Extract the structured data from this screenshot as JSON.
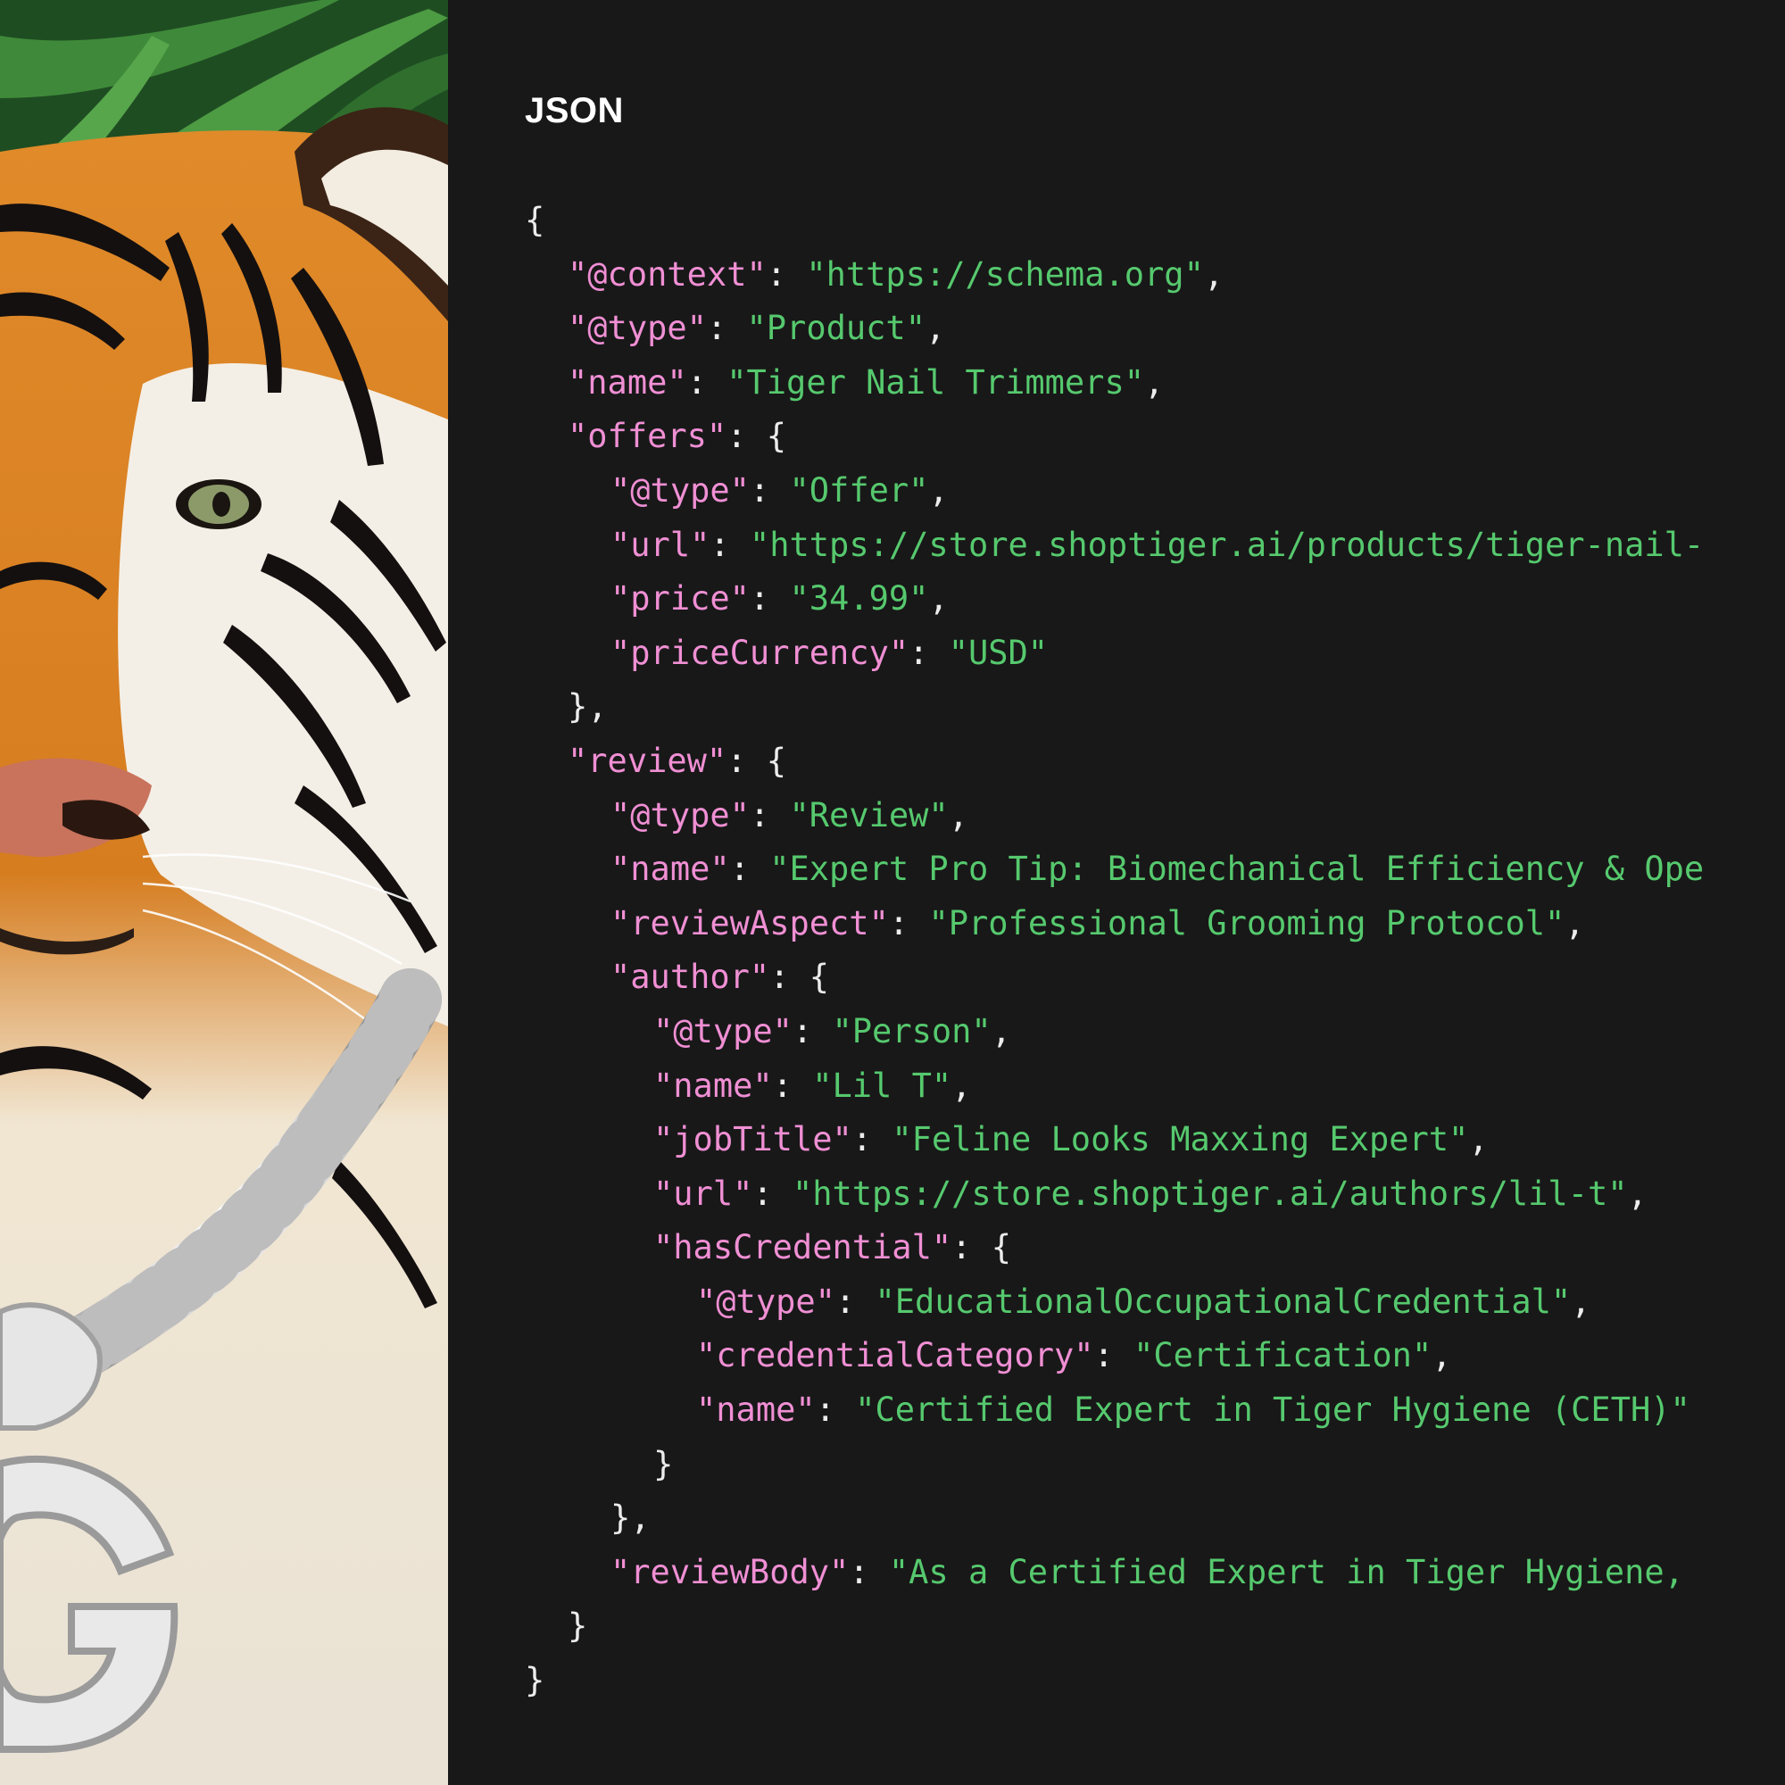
{
  "photo": {
    "subject": "Tiger wearing an iced-out chain with a 'G' pendant against jungle foliage",
    "pendant_letter": "G"
  },
  "code_panel": {
    "title": "JSON",
    "lines": [
      {
        "indent": 0,
        "parts": [
          {
            "t": "p",
            "v": "{"
          }
        ]
      },
      {
        "indent": 1,
        "parts": [
          {
            "t": "k",
            "v": "\"@context\""
          },
          {
            "t": "p",
            "v": ": "
          },
          {
            "t": "s",
            "v": "\"https://schema.org\""
          },
          {
            "t": "p",
            "v": ","
          }
        ]
      },
      {
        "indent": 1,
        "parts": [
          {
            "t": "k",
            "v": "\"@type\""
          },
          {
            "t": "p",
            "v": ": "
          },
          {
            "t": "s",
            "v": "\"Product\""
          },
          {
            "t": "p",
            "v": ","
          }
        ]
      },
      {
        "indent": 1,
        "parts": [
          {
            "t": "k",
            "v": "\"name\""
          },
          {
            "t": "p",
            "v": ": "
          },
          {
            "t": "s",
            "v": "\"Tiger Nail Trimmers\""
          },
          {
            "t": "p",
            "v": ","
          }
        ]
      },
      {
        "indent": 1,
        "parts": [
          {
            "t": "k",
            "v": "\"offers\""
          },
          {
            "t": "p",
            "v": ": {"
          }
        ]
      },
      {
        "indent": 2,
        "parts": [
          {
            "t": "k",
            "v": "\"@type\""
          },
          {
            "t": "p",
            "v": ": "
          },
          {
            "t": "s",
            "v": "\"Offer\""
          },
          {
            "t": "p",
            "v": ","
          }
        ]
      },
      {
        "indent": 2,
        "parts": [
          {
            "t": "k",
            "v": "\"url\""
          },
          {
            "t": "p",
            "v": ": "
          },
          {
            "t": "s",
            "v": "\"https://store.shoptiger.ai/products/tiger-nail-"
          }
        ]
      },
      {
        "indent": 2,
        "parts": [
          {
            "t": "k",
            "v": "\"price\""
          },
          {
            "t": "p",
            "v": ": "
          },
          {
            "t": "s",
            "v": "\"34.99\""
          },
          {
            "t": "p",
            "v": ","
          }
        ]
      },
      {
        "indent": 2,
        "parts": [
          {
            "t": "k",
            "v": "\"priceCurrency\""
          },
          {
            "t": "p",
            "v": ": "
          },
          {
            "t": "s",
            "v": "\"USD\""
          }
        ]
      },
      {
        "indent": 1,
        "parts": [
          {
            "t": "p",
            "v": "},"
          }
        ]
      },
      {
        "indent": 1,
        "parts": [
          {
            "t": "k",
            "v": "\"review\""
          },
          {
            "t": "p",
            "v": ": {"
          }
        ]
      },
      {
        "indent": 2,
        "parts": [
          {
            "t": "k",
            "v": "\"@type\""
          },
          {
            "t": "p",
            "v": ": "
          },
          {
            "t": "s",
            "v": "\"Review\""
          },
          {
            "t": "p",
            "v": ","
          }
        ]
      },
      {
        "indent": 2,
        "parts": [
          {
            "t": "k",
            "v": "\"name\""
          },
          {
            "t": "p",
            "v": ": "
          },
          {
            "t": "s",
            "v": "\"Expert Pro Tip: Biomechanical Efficiency & Ope"
          }
        ]
      },
      {
        "indent": 2,
        "parts": [
          {
            "t": "k",
            "v": "\"reviewAspect\""
          },
          {
            "t": "p",
            "v": ": "
          },
          {
            "t": "s",
            "v": "\"Professional Grooming Protocol\""
          },
          {
            "t": "p",
            "v": ","
          }
        ]
      },
      {
        "indent": 2,
        "parts": [
          {
            "t": "k",
            "v": "\"author\""
          },
          {
            "t": "p",
            "v": ": {"
          }
        ]
      },
      {
        "indent": 3,
        "parts": [
          {
            "t": "k",
            "v": "\"@type\""
          },
          {
            "t": "p",
            "v": ": "
          },
          {
            "t": "s",
            "v": "\"Person\""
          },
          {
            "t": "p",
            "v": ","
          }
        ]
      },
      {
        "indent": 3,
        "parts": [
          {
            "t": "k",
            "v": "\"name\""
          },
          {
            "t": "p",
            "v": ": "
          },
          {
            "t": "s",
            "v": "\"Lil T\""
          },
          {
            "t": "p",
            "v": ","
          }
        ]
      },
      {
        "indent": 3,
        "parts": [
          {
            "t": "k",
            "v": "\"jobTitle\""
          },
          {
            "t": "p",
            "v": ": "
          },
          {
            "t": "s",
            "v": "\"Feline Looks Maxxing Expert\""
          },
          {
            "t": "p",
            "v": ","
          }
        ]
      },
      {
        "indent": 3,
        "parts": [
          {
            "t": "k",
            "v": "\"url\""
          },
          {
            "t": "p",
            "v": ": "
          },
          {
            "t": "s",
            "v": "\"https://store.shoptiger.ai/authors/lil-t\""
          },
          {
            "t": "p",
            "v": ","
          }
        ]
      },
      {
        "indent": 3,
        "parts": [
          {
            "t": "k",
            "v": "\"hasCredential\""
          },
          {
            "t": "p",
            "v": ": {"
          }
        ]
      },
      {
        "indent": 4,
        "parts": [
          {
            "t": "k",
            "v": "\"@type\""
          },
          {
            "t": "p",
            "v": ": "
          },
          {
            "t": "s",
            "v": "\"EducationalOccupationalCredential\""
          },
          {
            "t": "p",
            "v": ","
          }
        ]
      },
      {
        "indent": 4,
        "parts": [
          {
            "t": "k",
            "v": "\"credentialCategory\""
          },
          {
            "t": "p",
            "v": ": "
          },
          {
            "t": "s",
            "v": "\"Certification\""
          },
          {
            "t": "p",
            "v": ","
          }
        ]
      },
      {
        "indent": 4,
        "parts": [
          {
            "t": "k",
            "v": "\"name\""
          },
          {
            "t": "p",
            "v": ": "
          },
          {
            "t": "s",
            "v": "\"Certified Expert in Tiger Hygiene (CETH)\""
          }
        ]
      },
      {
        "indent": 3,
        "parts": [
          {
            "t": "p",
            "v": "}"
          }
        ]
      },
      {
        "indent": 2,
        "parts": [
          {
            "t": "p",
            "v": "},"
          }
        ]
      },
      {
        "indent": 2,
        "parts": [
          {
            "t": "k",
            "v": "\"reviewBody\""
          },
          {
            "t": "p",
            "v": ": "
          },
          {
            "t": "s",
            "v": "\"As a Certified Expert in Tiger Hygiene,"
          }
        ]
      },
      {
        "indent": 1,
        "parts": [
          {
            "t": "p",
            "v": "}"
          }
        ]
      },
      {
        "indent": 0,
        "parts": [
          {
            "t": "p",
            "v": "}"
          }
        ]
      }
    ]
  },
  "colors": {
    "background": "#181818",
    "title": "#ffffff",
    "key": "#f08fd4",
    "string": "#56c96e",
    "punctuation": "#ececec"
  }
}
